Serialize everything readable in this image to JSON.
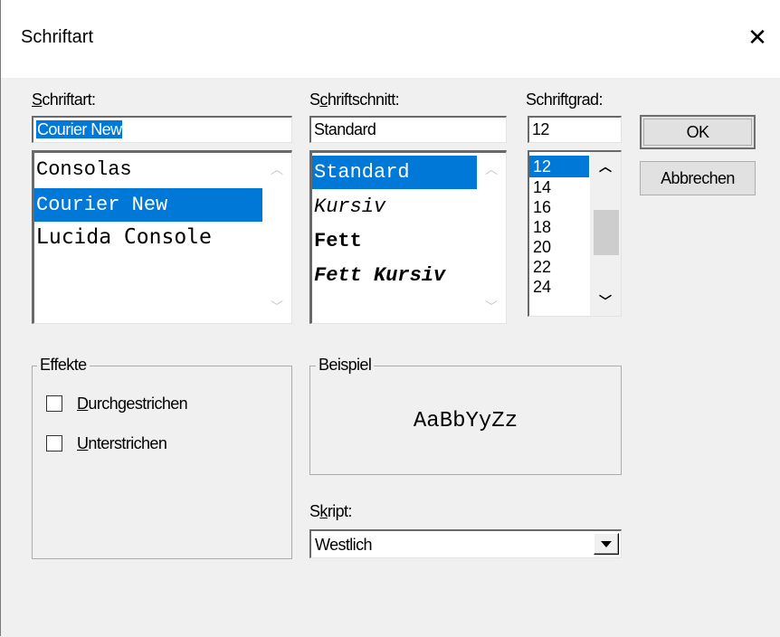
{
  "dialog": {
    "title": "Schriftart"
  },
  "font": {
    "label": "Schriftart:",
    "label_accel": "S",
    "label_rest": "chriftart:",
    "value": "Courier New",
    "items": [
      "Consolas",
      "Courier New",
      "Lucida Console"
    ],
    "selected_index": 1
  },
  "style": {
    "label_pre": "S",
    "label_accel": "c",
    "label_rest": "hriftschnitt:",
    "value": "Standard",
    "items": [
      "Standard",
      "Kursiv",
      "Fett",
      "Fett Kursiv"
    ],
    "selected_index": 0
  },
  "size": {
    "label_pre": "Schrift",
    "label_accel": "g",
    "label_rest": "rad:",
    "value": "12",
    "items": [
      "12",
      "14",
      "16",
      "18",
      "20",
      "22",
      "24"
    ],
    "selected_index": 0
  },
  "buttons": {
    "ok": "OK",
    "cancel": "Abbrechen"
  },
  "effects": {
    "caption": "Effekte",
    "strikeout_accel": "D",
    "strikeout_rest": "urchgestrichen",
    "strikeout_checked": false,
    "underline_accel": "U",
    "underline_rest": "nterstrichen",
    "underline_checked": false
  },
  "sample": {
    "caption": "Beispiel",
    "text": "AaBbYyZz"
  },
  "script": {
    "label_pre": "S",
    "label_accel": "k",
    "label_rest": "ript:",
    "value": "Westlich"
  },
  "colors": {
    "selection": "#0078d7",
    "dialog_bg": "#f0f0f0"
  },
  "icons": {
    "close": "close-icon",
    "scroll_up": "chevron-up-icon",
    "scroll_down": "chevron-down-icon",
    "combo": "dropdown-arrow-icon"
  }
}
